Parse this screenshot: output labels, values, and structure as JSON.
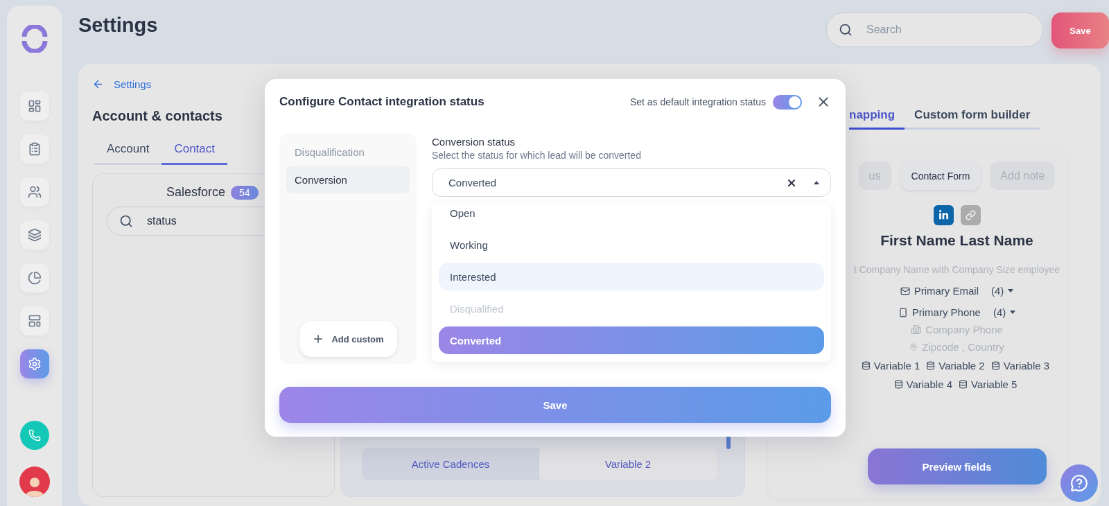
{
  "sidebar": {
    "nav": [
      {
        "kind": "dashboard",
        "selected": false
      },
      {
        "kind": "clipboard",
        "selected": false
      },
      {
        "kind": "people",
        "selected": false
      },
      {
        "kind": "stack",
        "selected": false
      },
      {
        "kind": "pie",
        "selected": false
      },
      {
        "kind": "layout",
        "selected": false
      },
      {
        "kind": "settings",
        "selected": true
      }
    ]
  },
  "header": {
    "title": "Settings",
    "search": {
      "placeholder": "Search"
    },
    "save_button": "Save"
  },
  "settings_panel": {
    "back_link": "Settings",
    "title": "Account & contacts",
    "tabs": [
      {
        "label": "Account",
        "selected": false
      },
      {
        "label": "Contact",
        "selected": true
      }
    ],
    "source": {
      "name": "Salesforce",
      "count": "54"
    },
    "search": {
      "value": "status"
    }
  },
  "field_table": {
    "rows": [
      {
        "column_1": "Active Cadences",
        "column_2": "Variable 2"
      }
    ]
  },
  "preview": {
    "tabs": [
      {
        "label": "napping",
        "selected": true
      },
      {
        "label": "Custom form builder",
        "selected": false
      }
    ],
    "actions": [
      {
        "label": "us",
        "disabled": true
      },
      {
        "label": "Contact Form",
        "disabled": false
      },
      {
        "label": "Add note",
        "disabled": true
      }
    ],
    "links": [
      {
        "kind": "linkedin"
      },
      {
        "kind": "link"
      }
    ],
    "name": "First Name Last Name",
    "headline": "t Company Name with Company Size employee",
    "contacts": [
      {
        "kind": "email",
        "label": "Primary Email",
        "count": "(4)",
        "muted": false
      },
      {
        "kind": "phone",
        "label": "Primary Phone",
        "count": "(4)",
        "muted": false
      },
      {
        "kind": "company_phone",
        "label": "Company Phone",
        "muted": true
      },
      {
        "kind": "location",
        "label": "Zipcode , Country",
        "muted": true
      }
    ],
    "variables": [
      [
        "Variable 1",
        "Variable 2",
        "Variable 3"
      ],
      [
        "Variable 4",
        "Variable 5"
      ]
    ],
    "preview_button": "Preview fields"
  },
  "modal": {
    "title": "Configure Contact integration status",
    "default_toggle": {
      "label": "Set as default integration status",
      "on": true
    },
    "sections": [
      {
        "label": "Disqualification",
        "selected": false
      },
      {
        "label": "Conversion",
        "selected": true
      }
    ],
    "add_custom": "Add custom",
    "field": {
      "label": "Conversion status",
      "description": "Select the status for which lead will be converted",
      "value": "Converted",
      "expanded": true
    },
    "options": [
      {
        "label": "Open",
        "selected": false,
        "disabled": false,
        "highlighted": false
      },
      {
        "label": "Working",
        "selected": false,
        "disabled": false,
        "highlighted": false
      },
      {
        "label": "Interested",
        "selected": false,
        "disabled": false,
        "highlighted": true
      },
      {
        "label": "Disqualified",
        "selected": false,
        "disabled": true,
        "highlighted": false
      },
      {
        "label": "Converted",
        "selected": true,
        "disabled": false,
        "highlighted": false
      }
    ],
    "save": "Save"
  }
}
